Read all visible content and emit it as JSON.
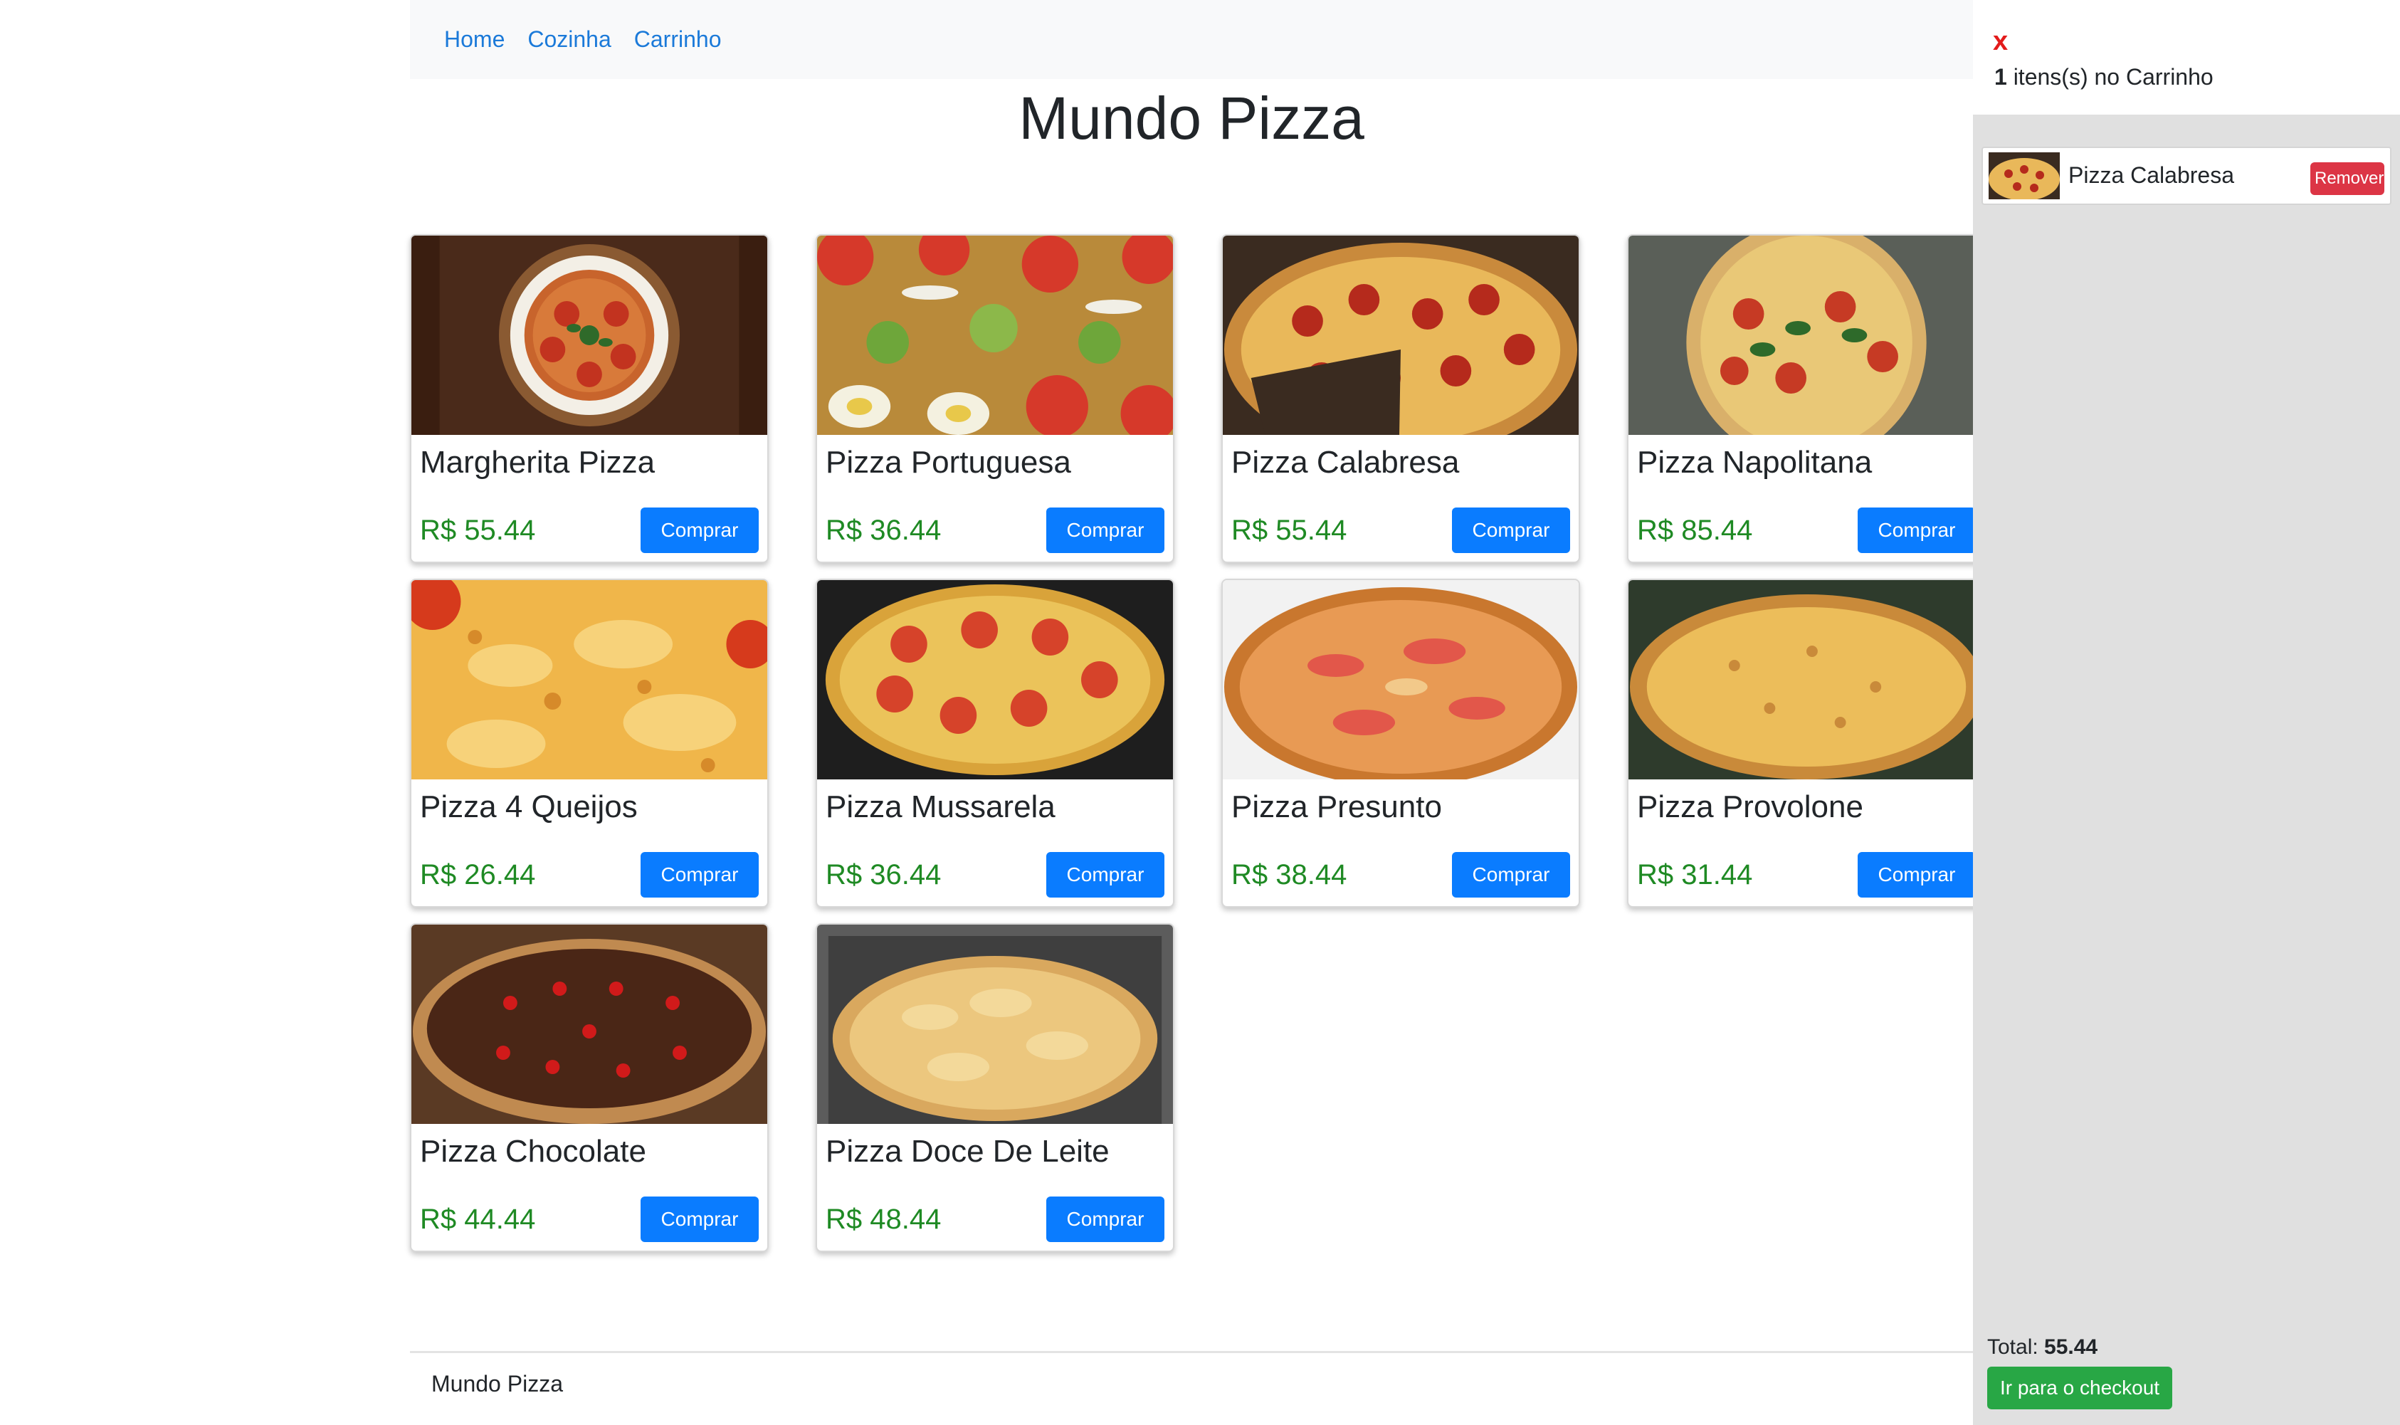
{
  "nav": {
    "items": [
      "Home",
      "Cozinha",
      "Carrinho"
    ]
  },
  "page": {
    "title": "Mundo Pizza"
  },
  "products": [
    {
      "name": "Margherita Pizza",
      "price": "R$ 55.44",
      "button": "Comprar"
    },
    {
      "name": "Pizza Portuguesa",
      "price": "R$ 36.44",
      "button": "Comprar"
    },
    {
      "name": "Pizza Calabresa",
      "price": "R$ 55.44",
      "button": "Comprar"
    },
    {
      "name": "Pizza Napolitana",
      "price": "R$ 85.44",
      "button": "Comprar"
    },
    {
      "name": "Pizza 4 Queijos",
      "price": "R$ 26.44",
      "button": "Comprar"
    },
    {
      "name": "Pizza Mussarela",
      "price": "R$ 36.44",
      "button": "Comprar"
    },
    {
      "name": "Pizza Presunto",
      "price": "R$ 38.44",
      "button": "Comprar"
    },
    {
      "name": "Pizza Provolone",
      "price": "R$ 31.44",
      "button": "Comprar"
    },
    {
      "name": "Pizza Chocolate",
      "price": "R$ 44.44",
      "button": "Comprar"
    },
    {
      "name": "Pizza Doce De Leite",
      "price": "R$ 48.44",
      "button": "Comprar"
    }
  ],
  "footer": {
    "text": "Mundo Pizza"
  },
  "cart": {
    "close_label": "x",
    "count": "1",
    "count_suffix": " itens(s) no Carrinho",
    "items": [
      {
        "name": "Pizza Calabresa",
        "remove_label": "Remover"
      }
    ],
    "total_label": "Total: ",
    "total_value": "55.44",
    "checkout_label": "Ir para o checkout"
  },
  "colors": {
    "primary_button": "#0a7cff",
    "price_green": "#1f8a24",
    "remove_red": "#dc3545",
    "checkout_green": "#28a745",
    "close_red": "#e31b1b"
  }
}
